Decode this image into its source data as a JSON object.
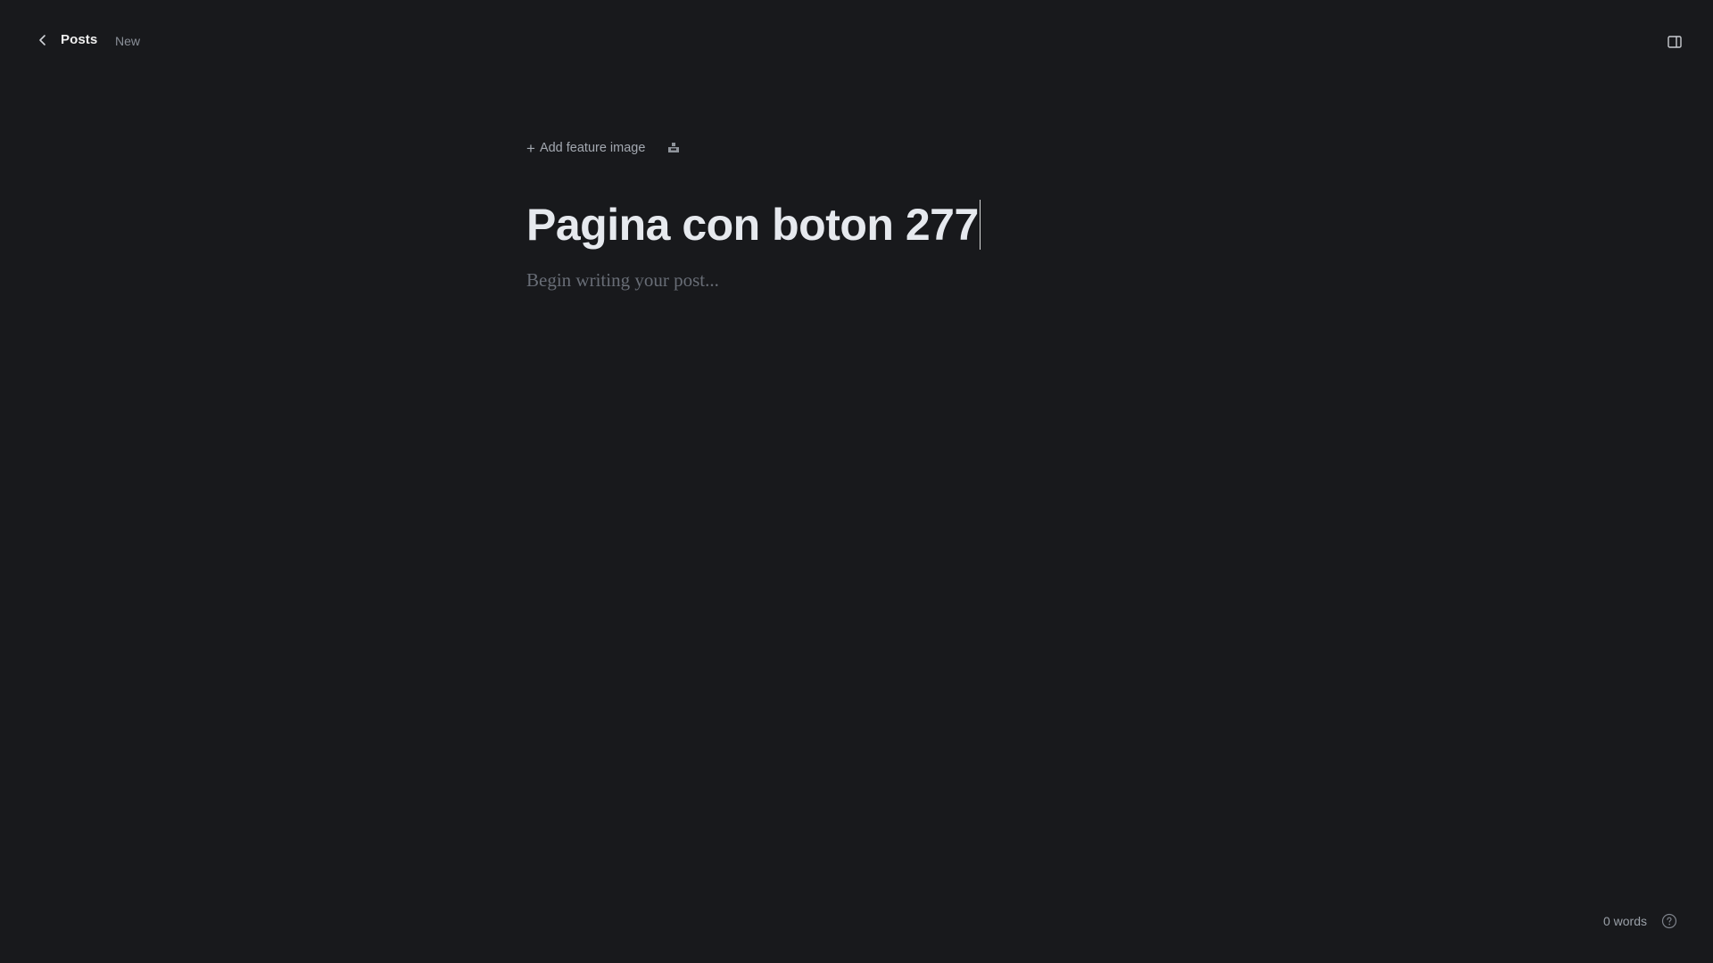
{
  "header": {
    "back_label": "Posts",
    "status_label": "New",
    "icons": {
      "back": "chevron-left-icon",
      "panel": "sidebar-toggle-icon"
    }
  },
  "editor": {
    "add_feature_image_label": "Add feature image",
    "title": "Pagina con boton 277",
    "body_placeholder": "Begin writing your post...",
    "icons": {
      "add": "plus-icon",
      "snippet": "snippet-icon"
    }
  },
  "footer": {
    "word_count": "0 words",
    "icons": {
      "help": "help-icon"
    }
  },
  "colors": {
    "background": "#18191c",
    "title": "#e6e9ee",
    "muted": "#8a8f98",
    "placeholder": "#686d76"
  }
}
